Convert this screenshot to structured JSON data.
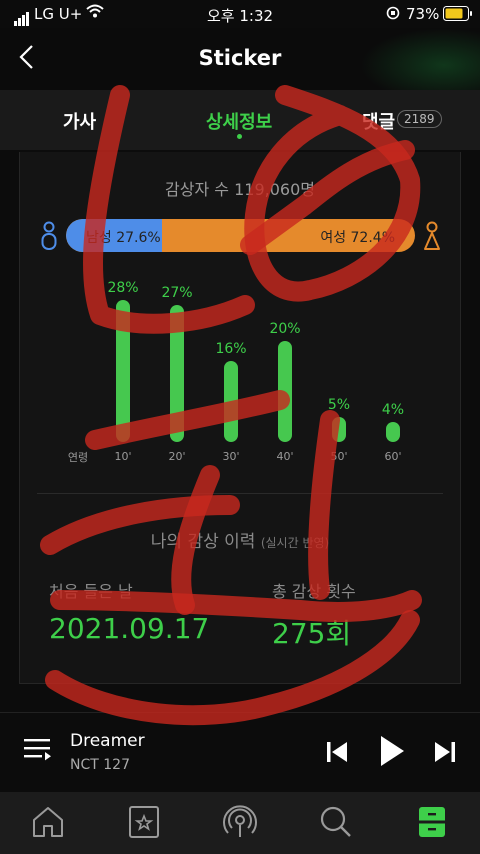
{
  "status": {
    "carrier": "LG U+",
    "time": "오후 1:32",
    "battery": "73%"
  },
  "header": {
    "title": "Sticker"
  },
  "tabs": [
    {
      "label": "가사"
    },
    {
      "label": "상세정보"
    },
    {
      "label": "댓글",
      "badge": "2189"
    }
  ],
  "listeners": "감상자 수 119,060명",
  "gender": {
    "male_label": "남성 27.6%",
    "female_label": "여성 72.4%",
    "male_fraction": 0.276
  },
  "age_chart": {
    "age_label": "연령",
    "bars": [
      {
        "age": "10'",
        "pct": "28%",
        "value": 28
      },
      {
        "age": "20'",
        "pct": "27%",
        "value": 27
      },
      {
        "age": "30'",
        "pct": "16%",
        "value": 16
      },
      {
        "age": "40'",
        "pct": "20%",
        "value": 20
      },
      {
        "age": "50'",
        "pct": "5%",
        "value": 5
      },
      {
        "age": "60'",
        "pct": "4%",
        "value": 4
      }
    ]
  },
  "history": {
    "title": "나의 감상 이력",
    "subtitle": "(실시간 반영)",
    "first_label": "처음 들은 날",
    "first_value": "2021.09.17",
    "count_label": "총 감상 횟수",
    "count_value": "275회"
  },
  "player": {
    "song": "Dreamer",
    "artist": "NCT 127"
  },
  "colors": {
    "accent": "#3ecf4a",
    "male": "#4e8de8",
    "female": "#e58a2c"
  }
}
